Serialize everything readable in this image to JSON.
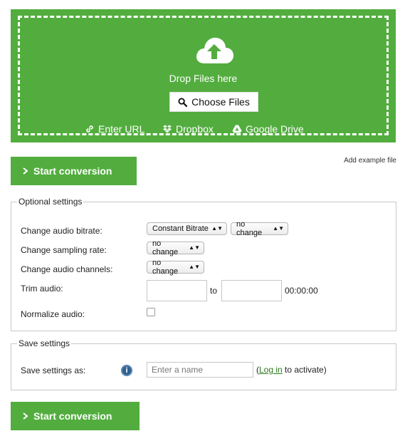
{
  "upload": {
    "icon": "cloud-upload-icon",
    "drop_text": "Drop Files here",
    "choose_label": "Choose Files",
    "sources": [
      {
        "label": "Enter URL",
        "icon": "link-icon"
      },
      {
        "label": "Dropbox",
        "icon": "dropbox-icon"
      },
      {
        "label": "Google Drive",
        "icon": "google-drive-icon"
      }
    ]
  },
  "actions": {
    "start_label": "Start conversion",
    "add_example": "Add example file"
  },
  "optional": {
    "legend": "Optional settings",
    "bitrate_label": "Change audio bitrate:",
    "bitrate_mode": "Constant Bitrate",
    "bitrate_value": "no change",
    "sampling_label": "Change sampling rate:",
    "sampling_value": "no change",
    "channels_label": "Change audio channels:",
    "channels_value": "no change",
    "trim_label": "Trim audio:",
    "trim_to": "to",
    "trim_duration": "00:00:00",
    "normalize_label": "Normalize audio:"
  },
  "save": {
    "legend": "Save settings",
    "label": "Save settings as:",
    "placeholder": "Enter a name",
    "open_paren": "(",
    "login_text": "Log in",
    "activate_text": " to activate)"
  },
  "colors": {
    "brand_green": "#52ad3e",
    "link_green": "#2b7a1b",
    "info_blue": "#2f5f8d"
  }
}
